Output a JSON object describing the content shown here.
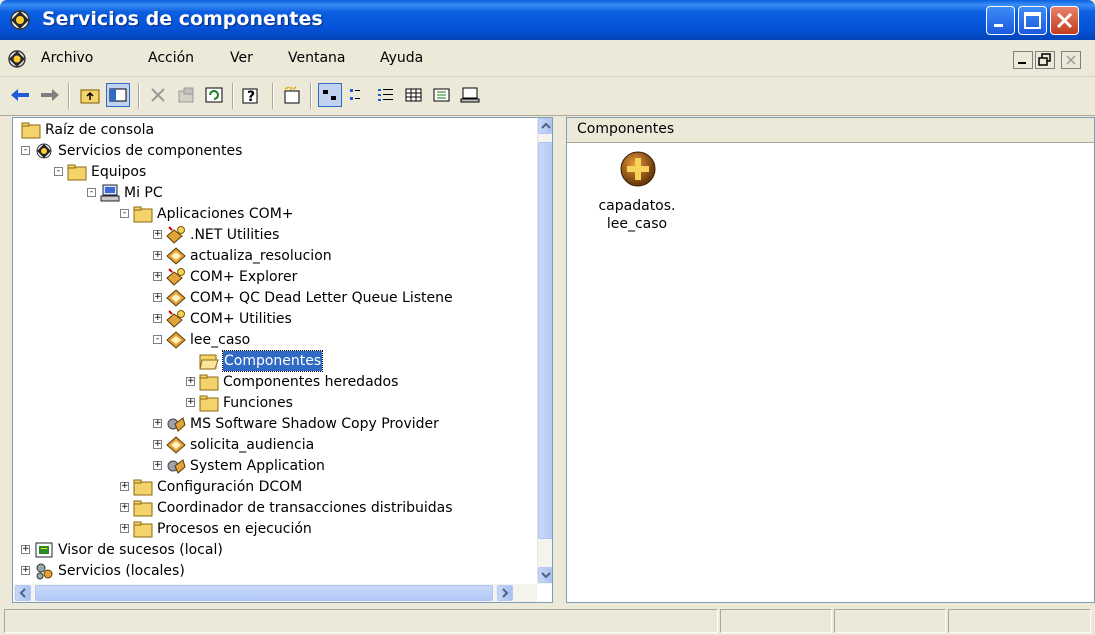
{
  "window": {
    "title": "Servicios de componentes"
  },
  "menubar": {
    "items": [
      "Archivo",
      "Acción",
      "Ver",
      "Ventana",
      "Ayuda"
    ]
  },
  "toolbar": {
    "tools": [
      "back-icon",
      "forward-icon",
      "up-folder-icon",
      "show-hide-tree-icon",
      "delete-icon",
      "properties-icon",
      "refresh-icon",
      "help-icon",
      "new-window-icon",
      "large-icons-view-icon",
      "small-icons-view-icon",
      "list-view-icon",
      "details-view-icon",
      "status-view-icon",
      "computer-view-icon"
    ]
  },
  "tree": {
    "items": [
      {
        "label": "Raíz de consola",
        "icon": "folder-icon"
      },
      {
        "label": "Servicios de componentes",
        "icon": "component-services-icon"
      },
      {
        "label": "Equipos",
        "icon": "folder-icon"
      },
      {
        "label": "Mi PC",
        "icon": "computer-icon"
      },
      {
        "label": "Aplicaciones COM+",
        "icon": "folder-icon"
      },
      {
        "label": ".NET Utilities",
        "icon": "com-app-running-icon"
      },
      {
        "label": "actualiza_resolucion",
        "icon": "com-app-icon"
      },
      {
        "label": "COM+ Explorer",
        "icon": "com-app-running-icon"
      },
      {
        "label": "COM+ QC Dead Letter Queue Listene",
        "icon": "com-app-icon"
      },
      {
        "label": "COM+ Utilities",
        "icon": "com-app-running-icon"
      },
      {
        "label": "lee_caso",
        "icon": "com-app-icon"
      },
      {
        "label": "Componentes",
        "icon": "folder-open-icon"
      },
      {
        "label": "Componentes heredados",
        "icon": "folder-icon"
      },
      {
        "label": "Funciones",
        "icon": "folder-icon"
      },
      {
        "label": "MS Software Shadow Copy Provider",
        "icon": "com-system-app-icon"
      },
      {
        "label": "solicita_audiencia",
        "icon": "com-app-icon"
      },
      {
        "label": "System Application",
        "icon": "com-system-app-icon"
      },
      {
        "label": "Configuración DCOM",
        "icon": "folder-icon"
      },
      {
        "label": "Coordinador de transacciones distribuidas",
        "icon": "folder-icon"
      },
      {
        "label": "Procesos en ejecución",
        "icon": "folder-icon"
      },
      {
        "label": "Visor de sucesos (local)",
        "icon": "event-viewer-icon"
      },
      {
        "label": "Servicios (locales)",
        "icon": "services-icon"
      }
    ],
    "selected": "Componentes"
  },
  "rightpane": {
    "header": "Componentes",
    "items": [
      {
        "label_line1": "capadatos.",
        "label_line2": "lee_caso",
        "icon": "component-icon"
      }
    ]
  },
  "colors": {
    "titlebar": "#0553d8",
    "selection": "#316ac5",
    "chrome": "#ece9d8"
  }
}
